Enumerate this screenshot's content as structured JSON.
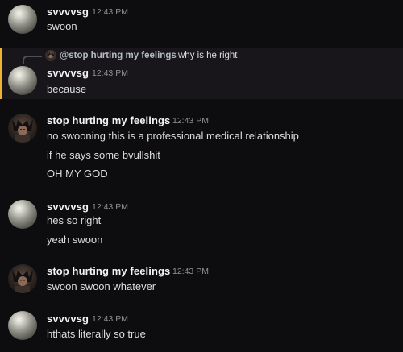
{
  "messages": [
    {
      "author": "svvvvsg",
      "time": "12:43 PM",
      "lines": [
        "swoon"
      ]
    },
    {
      "reply": {
        "mention": "@stop hurting my feelings",
        "text": "why is he right"
      },
      "author": "svvvvsg",
      "time": "12:43 PM",
      "lines": [
        "because"
      ]
    },
    {
      "author": "stop hurting my feelings",
      "time": "12:43 PM",
      "lines": [
        "no swooning this is a professional medical relationship",
        "if he says some bvullshit",
        "OH MY GOD"
      ]
    },
    {
      "author": "svvvvsg",
      "time": "12:43 PM",
      "lines": [
        "hes so right",
        "yeah swoon"
      ]
    },
    {
      "author": "stop hurting my feelings",
      "time": "12:43 PM",
      "lines": [
        "swoon swoon whatever"
      ]
    },
    {
      "author": "svvvvsg",
      "time": "12:43 PM",
      "lines": [
        "hthats literally so true"
      ]
    }
  ],
  "colors": {
    "background": "#0d0d0f",
    "reply_highlight_bar": "#f0b232",
    "reply_highlight_bg": "#18161a"
  }
}
